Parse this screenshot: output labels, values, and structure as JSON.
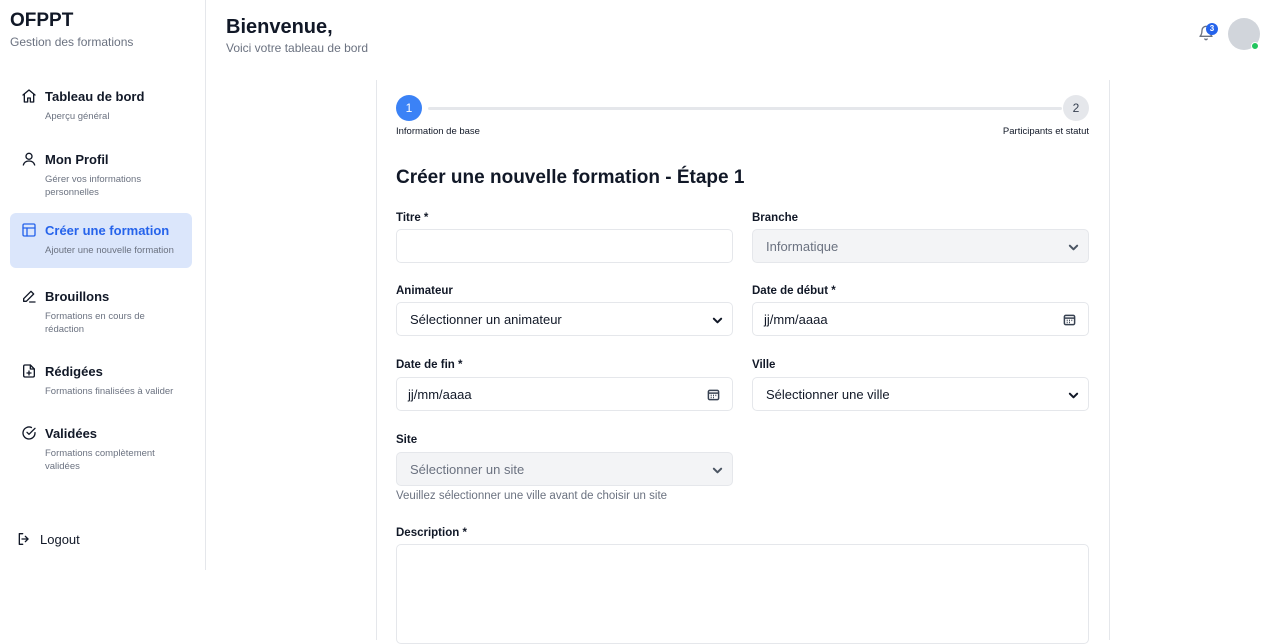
{
  "brand": {
    "title": "OFPPT",
    "subtitle": "Gestion des formations"
  },
  "sidebar": {
    "items": [
      {
        "label": "Tableau de bord",
        "desc": "Aperçu général",
        "icon": "home-icon"
      },
      {
        "label": "Mon Profil",
        "desc": "Gérer vos informations personnelles",
        "icon": "user-icon"
      },
      {
        "label": "Créer une formation",
        "desc": "Ajouter une nouvelle formation",
        "icon": "layout-icon",
        "active": true
      },
      {
        "label": "Brouillons",
        "desc": "Formations en cours de rédaction",
        "icon": "pencil-icon"
      },
      {
        "label": "Rédigées",
        "desc": "Formations finalisées à valider",
        "icon": "file-plus-icon"
      },
      {
        "label": "Validées",
        "desc": "Formations complètement validées",
        "icon": "check-circle-icon"
      }
    ],
    "logout_label": "Logout"
  },
  "header": {
    "title": "Bienvenue,",
    "subtitle": "Voici votre tableau de bord",
    "notification_count": "3"
  },
  "stepper": {
    "step1_number": "1",
    "step1_label": "Information de base",
    "step2_number": "2",
    "step2_label": "Participants et statut"
  },
  "form": {
    "title": "Créer une nouvelle formation - Étape 1",
    "titre_label": "Titre *",
    "titre_value": "",
    "branche_label": "Branche",
    "branche_value": "Informatique",
    "animateur_label": "Animateur",
    "animateur_value": "Sélectionner un animateur",
    "date_debut_label": "Date de début *",
    "date_debut_value": "jj/mm/aaaa",
    "date_fin_label": "Date de fin *",
    "date_fin_value": "jj/mm/aaaa",
    "ville_label": "Ville",
    "ville_value": "Sélectionner une ville",
    "site_label": "Site",
    "site_value": "Sélectionner un site",
    "site_helper": "Veuillez sélectionner une ville avant de choisir un site",
    "description_label": "Description *"
  },
  "colors": {
    "accent": "#2563eb",
    "active_bg": "#dbe6fb",
    "online": "#22c55e"
  }
}
